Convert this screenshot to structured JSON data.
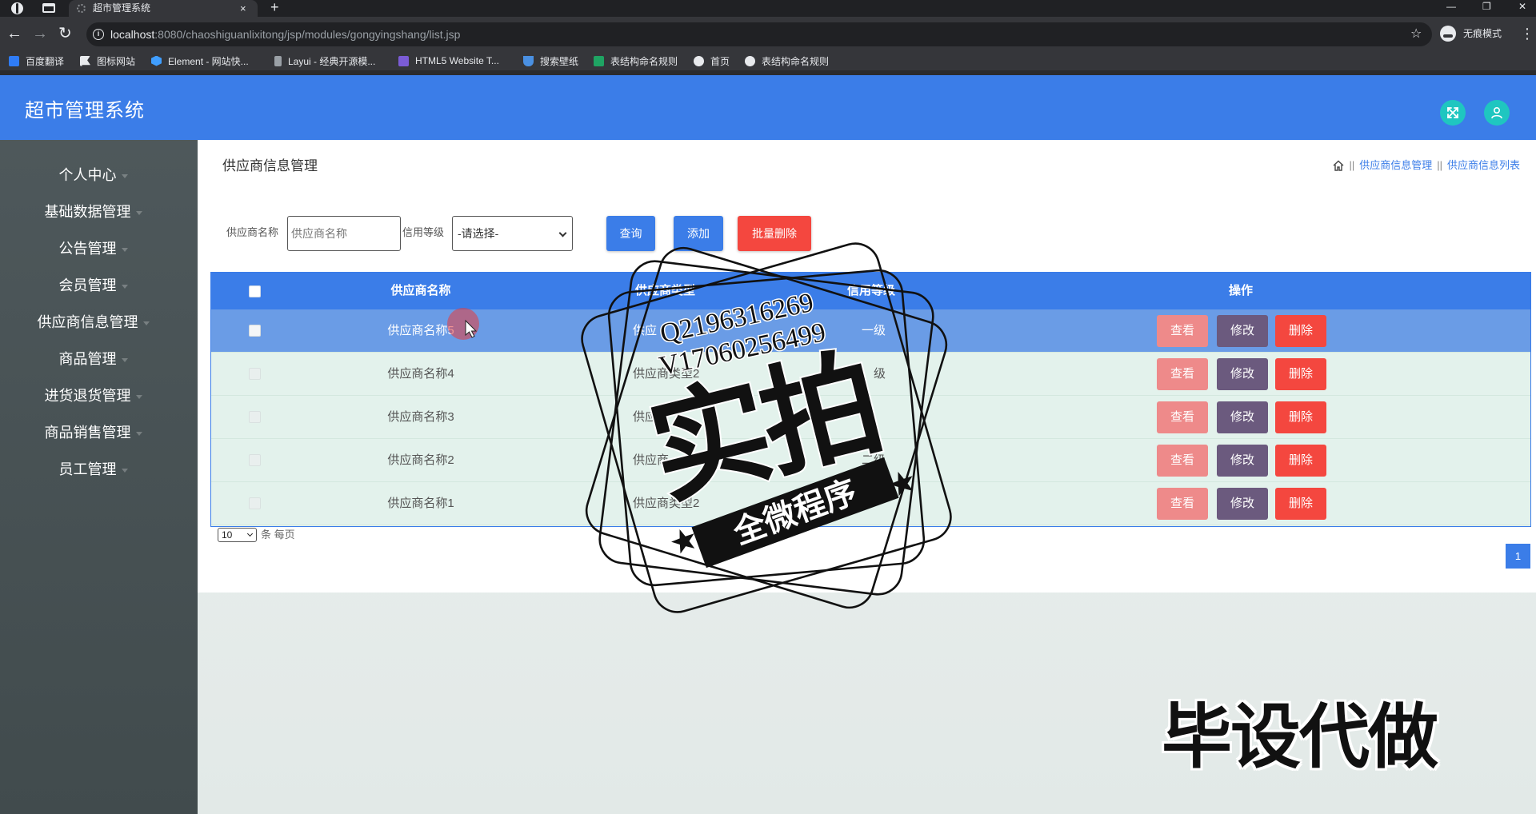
{
  "browser": {
    "tab_title": "超市管理系统",
    "tab_close": "×",
    "new_tab": "+",
    "window_controls": {
      "minimize": "—",
      "restore": "❐",
      "close": "✕"
    },
    "nav": {
      "back": "←",
      "forward": "→",
      "reload": "↻"
    },
    "url_host": "localhost",
    "url_path": ":8080/chaoshiguanlixitong/jsp/modules/gongyingshang/list.jsp",
    "star": "☆",
    "incognito_label": "无痕模式",
    "menu": "⋮",
    "bookmarks": [
      {
        "label": "百度翻译",
        "icon": "translate-icon",
        "color": "#2f7cf6"
      },
      {
        "label": "图标网站",
        "icon": "flag-icon",
        "color": "#e8eaed"
      },
      {
        "label": "Element - 网站快...",
        "icon": "element-icon",
        "color": "#409eff"
      },
      {
        "label": "Layui - 经典开源模...",
        "icon": "layui-icon",
        "color": "#9aa0a6"
      },
      {
        "label": "HTML5 Website T...",
        "icon": "html5-icon",
        "color": "#7b5cd6"
      },
      {
        "label": "搜索壁纸",
        "icon": "wallpaper-icon",
        "color": "#4a90e2"
      },
      {
        "label": "表结构命名规则",
        "icon": "sheet-icon",
        "color": "#1fa463"
      },
      {
        "label": "首页",
        "icon": "globe-icon",
        "color": "#e8eaed"
      },
      {
        "label": "表结构命名规则",
        "icon": "globe-icon",
        "color": "#e8eaed"
      }
    ]
  },
  "app": {
    "title": "超市管理系统",
    "header_icons": [
      "fullscreen-icon",
      "user-icon"
    ]
  },
  "sidebar": {
    "items": [
      {
        "label": "个人中心"
      },
      {
        "label": "基础数据管理"
      },
      {
        "label": "公告管理"
      },
      {
        "label": "会员管理"
      },
      {
        "label": "供应商信息管理"
      },
      {
        "label": "商品管理"
      },
      {
        "label": "进货退货管理"
      },
      {
        "label": "商品销售管理"
      },
      {
        "label": "员工管理"
      }
    ]
  },
  "page": {
    "title": "供应商信息管理",
    "breadcrumb_sep": "||",
    "breadcrumb": [
      "供应商信息管理",
      "供应商信息列表"
    ]
  },
  "search": {
    "name_label": "供应商名称",
    "name_placeholder": "供应商名称",
    "credit_label": "信用等级",
    "credit_selected": "-请选择-",
    "query_button": "查询",
    "add_button": "添加",
    "batch_delete_button": "批量删除"
  },
  "table": {
    "columns": {
      "name": "供应商名称",
      "type": "供应商类型",
      "credit": "信用等级",
      "ops": "操作"
    },
    "actions": {
      "view": "查看",
      "edit": "修改",
      "delete": "删除"
    },
    "rows": [
      {
        "name": "供应商名称5",
        "type": "供应",
        "credit": "一级"
      },
      {
        "name": "供应商名称4",
        "type": "供应商类型2",
        "credit": "级"
      },
      {
        "name": "供应商名称3",
        "type": "供应",
        "credit": ""
      },
      {
        "name": "供应商名称2",
        "type": "供应商",
        "credit": "二级"
      },
      {
        "name": "供应商名称1",
        "type": "供应商类型2",
        "credit": ""
      }
    ]
  },
  "pagination": {
    "page_size": "10",
    "page_size_suffix": "条 每页",
    "current_page": "1"
  },
  "watermark": {
    "qq": "Q2196316269",
    "vx": "V17060256499",
    "stamp_main": "实拍",
    "stamp_banner": "全微程序",
    "corner_text": "毕设代做"
  },
  "colors": {
    "primary": "#3b7de8",
    "danger": "#f4473f",
    "view": "#ee8a8a",
    "edit": "#6b5a7e",
    "sidebar": "#4b5458",
    "accent_teal": "#1fc6c0",
    "row_hover": "#6a9ce6",
    "row_bg": "#e3f2ec"
  }
}
